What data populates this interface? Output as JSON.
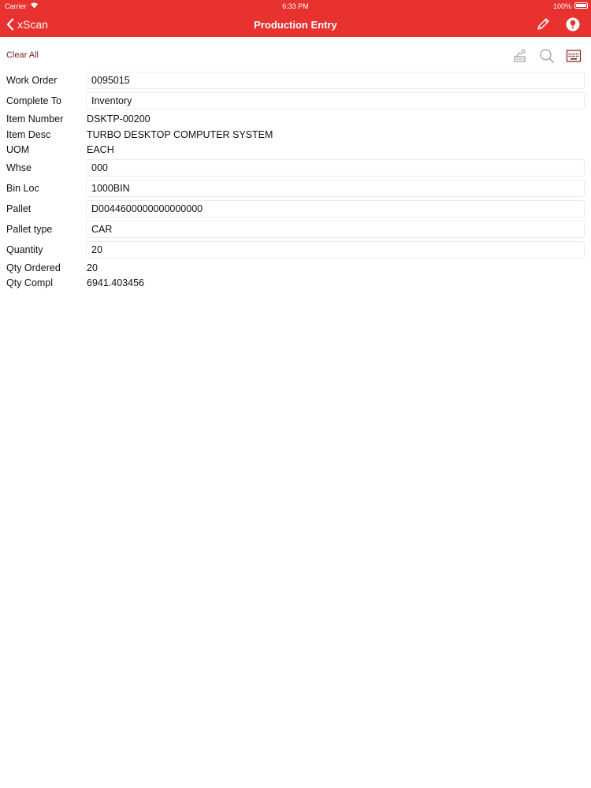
{
  "status_bar": {
    "carrier": "Carrier",
    "time": "6:33 PM",
    "battery": "100%"
  },
  "nav": {
    "back_label": "xScan",
    "title": "Production Entry",
    "accent": "#e8322f"
  },
  "toolbar": {
    "clear_all": "Clear All"
  },
  "form": {
    "work_order": {
      "label": "Work Order",
      "value": "0095015"
    },
    "complete_to": {
      "label": "Complete To",
      "value": "Inventory"
    },
    "item_number": {
      "label": "Item Number",
      "value": "DSKTP-00200"
    },
    "item_desc": {
      "label": "Item Desc",
      "value": "TURBO DESKTOP COMPUTER SYSTEM"
    },
    "uom": {
      "label": "UOM",
      "value": "EACH"
    },
    "whse": {
      "label": "Whse",
      "value": "000"
    },
    "bin_loc": {
      "label": "Bin Loc",
      "value": "1000BIN"
    },
    "pallet": {
      "label": "Pallet",
      "value": "D0044600000000000000"
    },
    "pallet_type": {
      "label": "Pallet type",
      "value": "CAR"
    },
    "quantity": {
      "label": "Quantity",
      "value": "20"
    },
    "qty_ordered": {
      "label": "Qty Ordered",
      "value": "20"
    },
    "qty_compl": {
      "label": "Qty Compl",
      "value": "6941.403456"
    }
  }
}
